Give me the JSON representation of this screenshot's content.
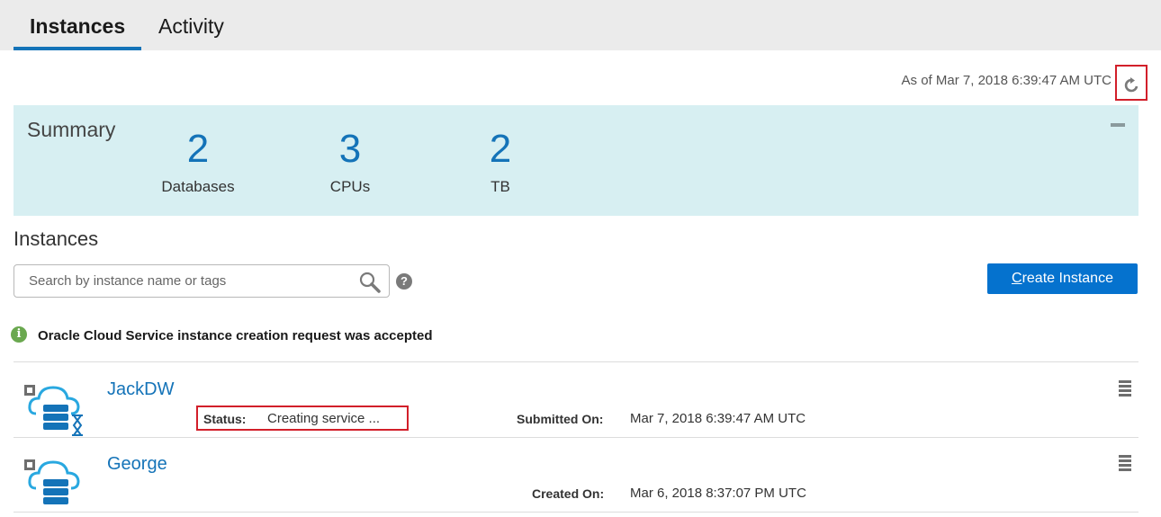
{
  "tabs": [
    {
      "label": "Instances",
      "active": true
    },
    {
      "label": "Activity",
      "active": false
    }
  ],
  "header": {
    "as_of": "As of Mar 7, 2018 6:39:47 AM UTC",
    "refresh_icon": "refresh-icon"
  },
  "summary": {
    "title": "Summary",
    "metrics": [
      {
        "value": "2",
        "label": "Databases"
      },
      {
        "value": "3",
        "label": "CPUs"
      },
      {
        "value": "2",
        "label": "TB"
      }
    ],
    "collapse_icon": "minus-icon"
  },
  "instances_section": {
    "title": "Instances",
    "search_placeholder": "Search by instance name or tags",
    "search_value": "",
    "help_glyph": "?",
    "create_button": {
      "first_letter": "C",
      "rest": "reate Instance"
    }
  },
  "notice": {
    "icon_glyph": "i",
    "text": "Oracle Cloud Service instance creation request was accepted"
  },
  "instances": [
    {
      "name": "JackDW",
      "status_label": "Status:",
      "status_value": "Creating service ...",
      "date_label": "Submitted On:",
      "date_value": "Mar 7, 2018 6:39:47 AM UTC",
      "icon": "cloud-database-pending-icon"
    },
    {
      "name": "George",
      "date_label": "Created On:",
      "date_value": "Mar 6, 2018 8:37:07 PM UTC",
      "icon": "cloud-database-icon"
    }
  ],
  "colors": {
    "accent": "#1473b8",
    "button": "#0572ce",
    "summary_bg": "#d7eff2",
    "highlight": "#d21f2a",
    "success": "#6aa84f"
  }
}
